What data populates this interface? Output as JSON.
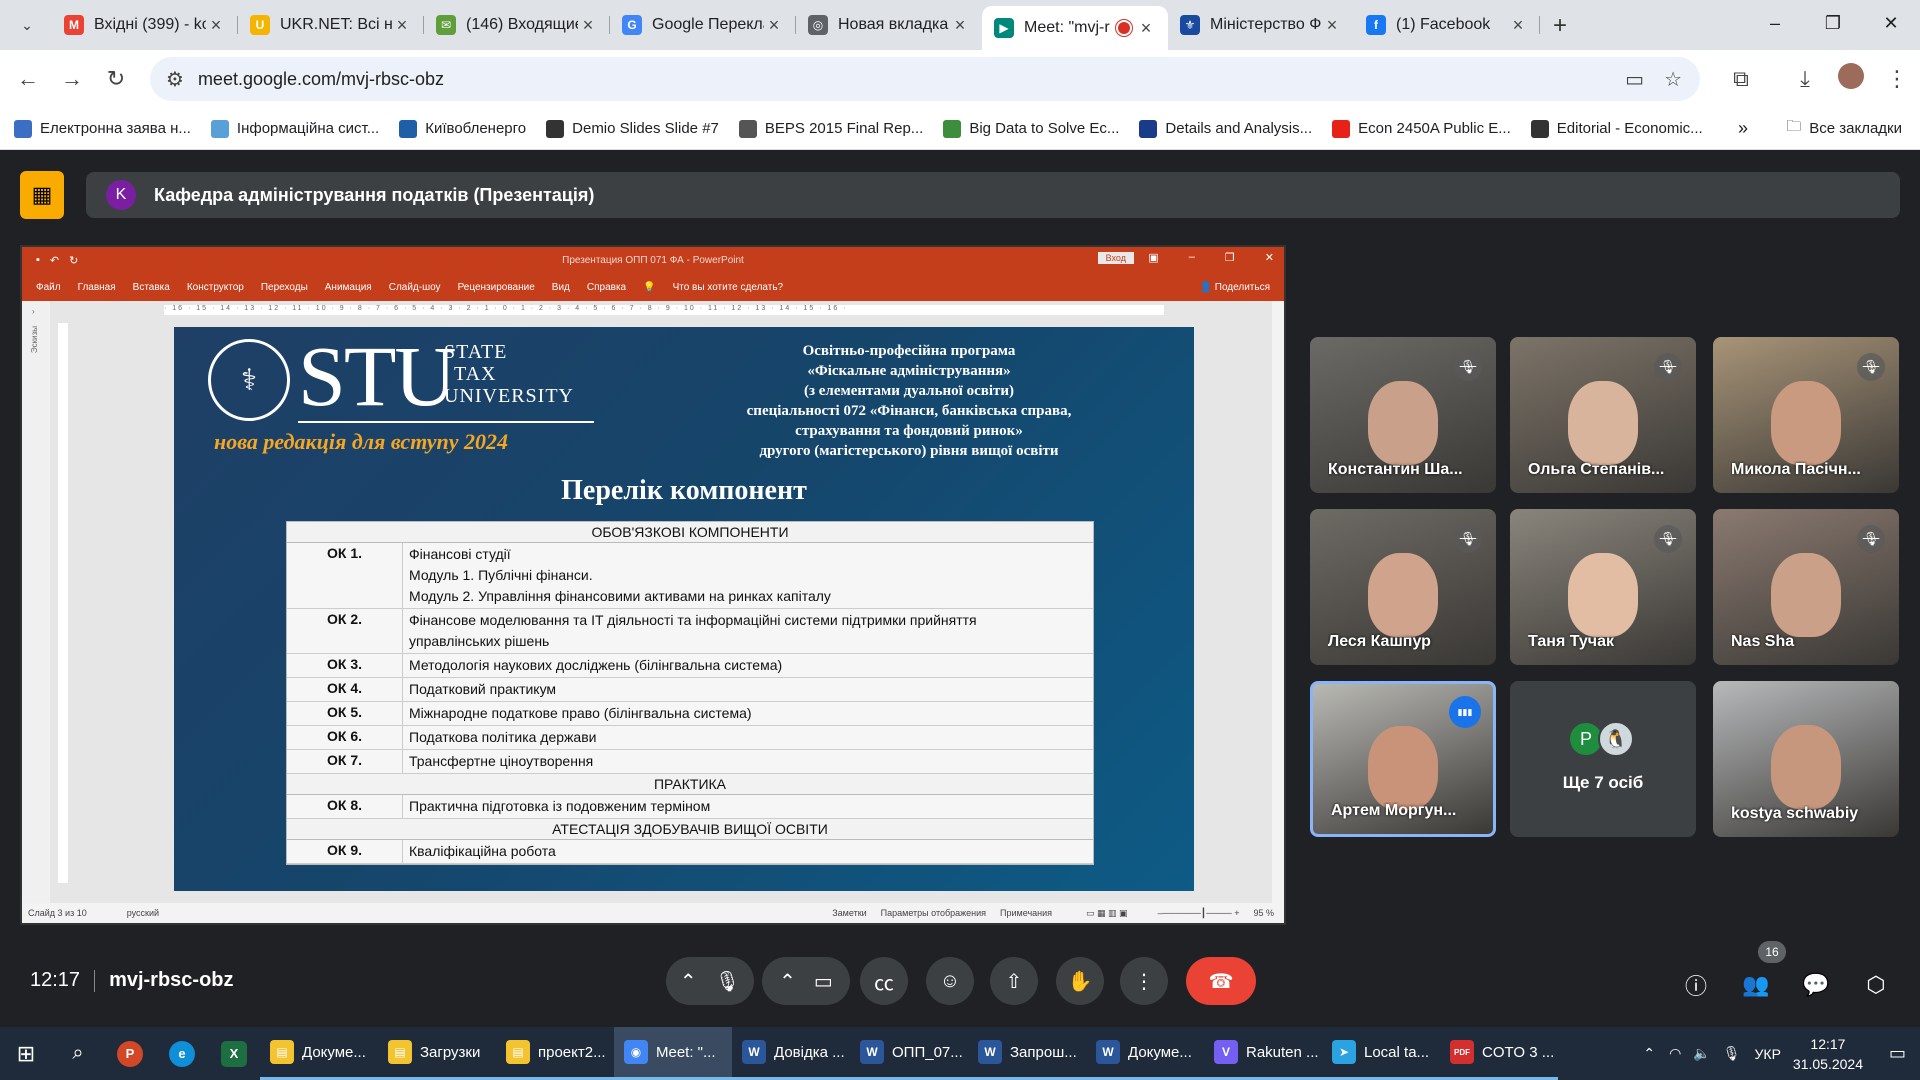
{
  "tabs": [
    {
      "title": "Вхідні (399) - ko",
      "color": "#ea4335",
      "glyph": "M"
    },
    {
      "title": "UKR.NET: Всі нов",
      "color": "#f4b400",
      "glyph": "U"
    },
    {
      "title": "(146) Входящие",
      "color": "#5f9e3a",
      "glyph": "✉"
    },
    {
      "title": "Google Перекла",
      "color": "#4285f4",
      "glyph": "G"
    },
    {
      "title": "Новая вкладка",
      "color": "#5f6368",
      "glyph": "◎"
    },
    {
      "title": "Meet: \"mvj-r",
      "color": "#00897b",
      "glyph": "▶"
    },
    {
      "title": "Міністерство Фі",
      "color": "#1a4aa0",
      "glyph": "⚜"
    },
    {
      "title": "(1) Facebook",
      "color": "#1877f2",
      "glyph": "f"
    }
  ],
  "address": {
    "url": "meet.google.com/mvj-rbsc-obz"
  },
  "bookmarks": [
    {
      "label": "Електронна заява н...",
      "color": "#3b6fc4"
    },
    {
      "label": "Інформаційна сист...",
      "color": "#5aa0d8"
    },
    {
      "label": "Київобленерго",
      "color": "#1f5fa8"
    },
    {
      "label": "Demio Slides Slide #7",
      "color": "#333333"
    },
    {
      "label": "BEPS 2015 Final Rep...",
      "color": "#555555"
    },
    {
      "label": "Big Data to Solve Ec...",
      "color": "#3c8d3c"
    },
    {
      "label": "Details and Analysis...",
      "color": "#1a3a8a"
    },
    {
      "label": "Econ 2450A Public E...",
      "color": "#e62117"
    },
    {
      "label": "Editorial - Economic...",
      "color": "#333333"
    }
  ],
  "bookmarks_all": "Все закладки",
  "meeting": {
    "avatar_letter": "K",
    "title": "Кафедра адміністрування податків (Презентація)",
    "time": "12:17",
    "code": "mvj-rbsc-obz",
    "people_count": "16"
  },
  "powerpoint": {
    "window_title": "Презентация ОПП 071 ФА  -  PowerPoint",
    "login": "Вход",
    "menu": [
      "Файл",
      "Главная",
      "Вставка",
      "Конструктор",
      "Переходы",
      "Анимация",
      "Слайд-шоу",
      "Рецензирование",
      "Вид",
      "Справка"
    ],
    "search_hint": "Что вы хотите сделать?",
    "share": "Поделиться",
    "left_panel": "Эскизы",
    "status_slide": "Слайд 3 из 10",
    "status_lang": "русский",
    "status_notes": "Заметки",
    "status_display": "Параметры отображения",
    "status_comments": "Примечания",
    "zoom": "95 %"
  },
  "slide": {
    "logo_big": "STU",
    "logo_small": [
      "STATE",
      "TAX",
      "UNIVERSITY"
    ],
    "edition": "нова редакція для вступу 2024",
    "program_lines": [
      "Освітньо-професійна програма",
      "«Фіскальне адміністрування»",
      "(з елементами дуальної освіти)",
      "спеціальності 072 «Фінанси, банківська справа,",
      "страхування та фондовий ринок»",
      "другого (магістерського) рівня вищої освіти"
    ],
    "heading": "Перелік компонент",
    "table": [
      {
        "type": "header",
        "text": "ОБОВ'ЯЗКОВІ КОМПОНЕНТИ"
      },
      {
        "type": "row",
        "code": "ОК 1.",
        "lines": [
          "Фінансові студії",
          "Модуль 1. Публічні фінанси.",
          "Модуль 2. Управління фінансовими активами на ринках капіталу"
        ]
      },
      {
        "type": "row",
        "code": "ОК 2.",
        "lines": [
          "Фінансове моделювання та IT діяльності та інформаційні системи підтримки прийняття",
          "управлінських рішень"
        ]
      },
      {
        "type": "row",
        "code": "ОК 3.",
        "lines": [
          "Методологія наукових досліджень  (білінгвальна система)"
        ]
      },
      {
        "type": "row",
        "code": "ОК 4.",
        "lines": [
          "Податковий практикум"
        ]
      },
      {
        "type": "row",
        "code": "ОК 5.",
        "lines": [
          "Міжнародне податкове право (білінгвальна система)"
        ]
      },
      {
        "type": "row",
        "code": "ОК 6.",
        "lines": [
          "Податкова політика держави"
        ]
      },
      {
        "type": "row",
        "code": "ОК 7.",
        "lines": [
          "Трансфертне ціноутворення"
        ]
      },
      {
        "type": "header",
        "text": "ПРАКТИКА"
      },
      {
        "type": "row",
        "code": "ОК 8.",
        "lines": [
          "Практична підготовка із подовженим терміном"
        ]
      },
      {
        "type": "header",
        "text": "АТЕСТАЦІЯ ЗДОБУВАЧІВ ВИЩОЇ ОСВІТИ"
      },
      {
        "type": "row",
        "code": "ОК 9.",
        "lines": [
          "Кваліфікаційна робота"
        ]
      }
    ]
  },
  "participants": [
    {
      "name": "Константин Ша...",
      "muted": true,
      "bg": "#6b6a66",
      "skin": "#c9a08a"
    },
    {
      "name": "Ольга Степанів...",
      "muted": true,
      "bg": "#7d7468",
      "skin": "#d9b49c"
    },
    {
      "name": "Микола Пасічн...",
      "muted": true,
      "bg": "#a89478",
      "skin": "#c99a80"
    },
    {
      "name": "Леся Кашпур",
      "muted": true,
      "bg": "#6e6a64",
      "skin": "#d0a48c"
    },
    {
      "name": "Таня Тучак",
      "muted": true,
      "bg": "#8a857c",
      "skin": "#e2bda4"
    },
    {
      "name": "Nas Sha",
      "muted": true,
      "bg": "#8b7a70",
      "skin": "#caa088"
    },
    {
      "name": "Артем Моргун...",
      "muted": false,
      "speaking": true,
      "bg": "#b9b9b4",
      "skin": "#c89378"
    },
    {
      "name": "kostya schwabiy",
      "muted": false,
      "bg": "#b7b9bb",
      "skin": "#c6977d"
    }
  ],
  "more_people": {
    "label": "Ще 7 осіб",
    "avatar_letter": "P"
  },
  "taskbar": {
    "apps": [
      {
        "label": "Докуме...",
        "color": "#f4c430",
        "glyph": "▤"
      },
      {
        "label": "Загрузки",
        "color": "#f4c430",
        "glyph": "▤"
      },
      {
        "label": "проект2...",
        "color": "#f4c430",
        "glyph": "▤"
      },
      {
        "label": "Meet: \"...",
        "color": "#4285f4",
        "glyph": "◉",
        "active": true
      },
      {
        "label": "Довідка ...",
        "color": "#2b579a",
        "glyph": "W"
      },
      {
        "label": "ОПП_07...",
        "color": "#2b579a",
        "glyph": "W"
      },
      {
        "label": "Запрош...",
        "color": "#2b579a",
        "glyph": "W"
      },
      {
        "label": "Докуме...",
        "color": "#2b579a",
        "glyph": "W"
      },
      {
        "label": "Rakuten ...",
        "color": "#7360f2",
        "glyph": "V"
      },
      {
        "label": "Local ta...",
        "color": "#2aa3e0",
        "glyph": "➤"
      },
      {
        "label": "COTO 3 ...",
        "color": "#d32f2f",
        "glyph": "PDF"
      }
    ],
    "lang": "УКР",
    "time": "12:17",
    "date": "31.05.2024"
  }
}
